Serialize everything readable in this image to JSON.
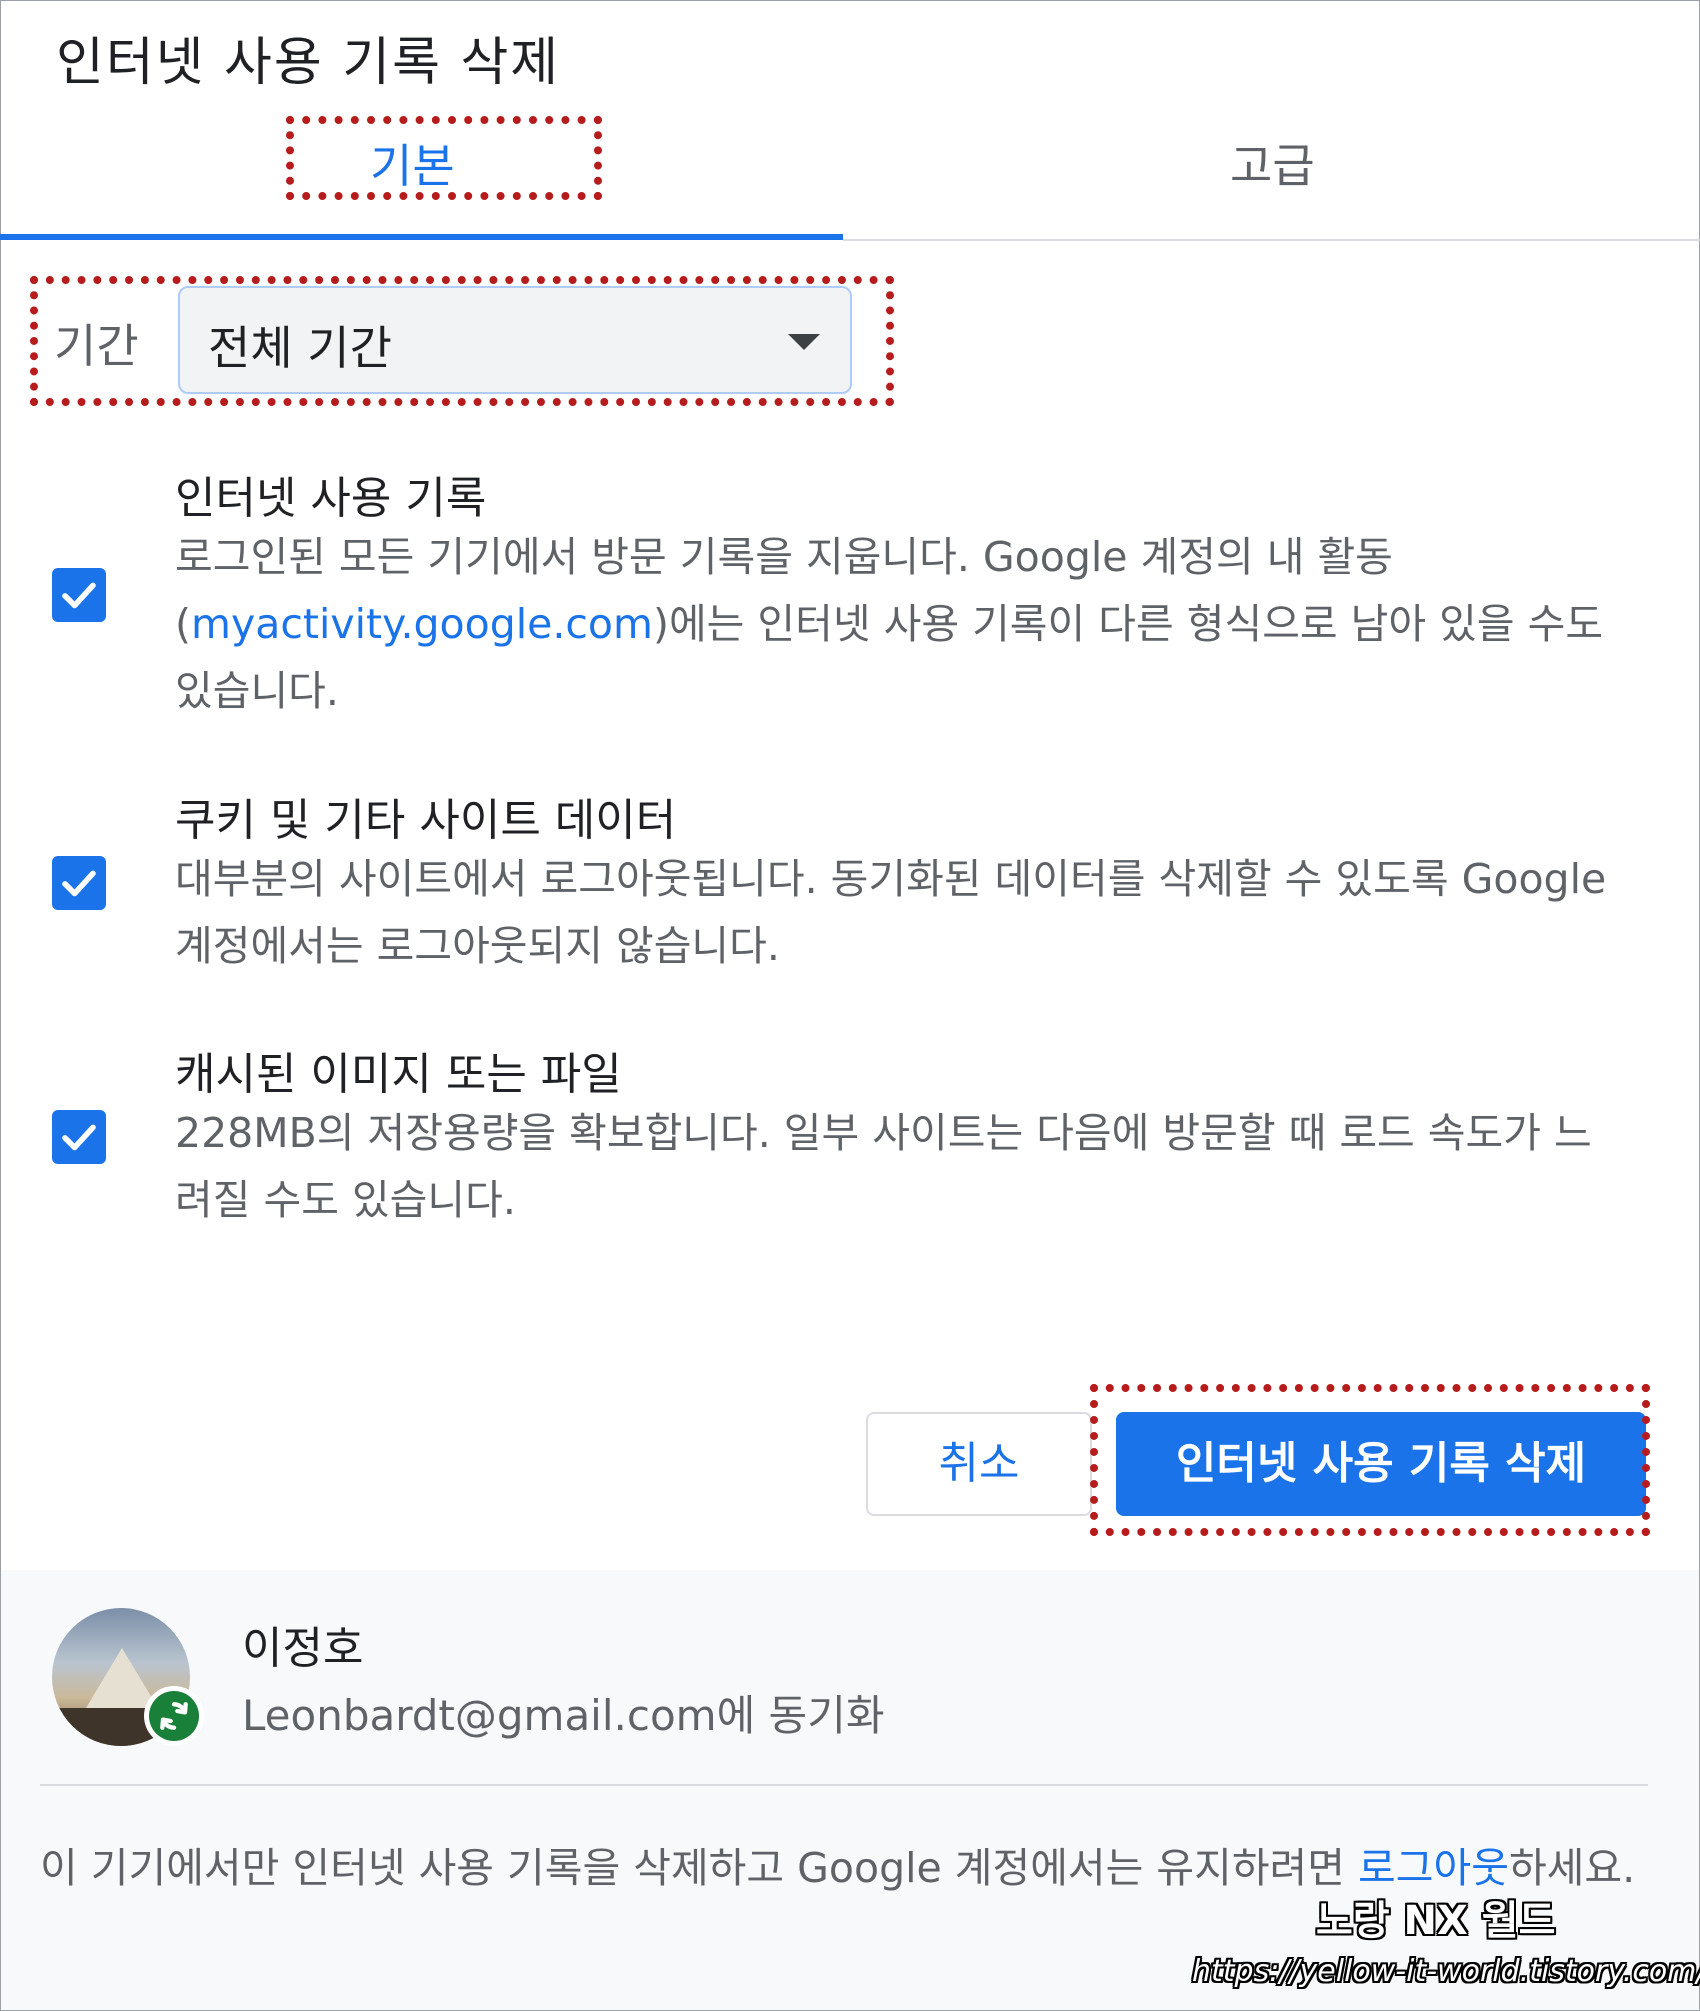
{
  "dialog": {
    "title": "인터넷 사용 기록 삭제"
  },
  "tabs": [
    {
      "label": "기본",
      "selected": true
    },
    {
      "label": "고급",
      "selected": false
    }
  ],
  "time_range": {
    "label": "기간",
    "value": "전체 기간"
  },
  "options": [
    {
      "title": "인터넷 사용 기록",
      "desc_before": "로그인된 모든 기기에서 방문 기록을 지웁니다. Google 계정의 내 활동 (",
      "desc_link": "myactivity.google.com",
      "desc_after": ")에는 인터넷 사용 기록이 다른 형식으로 남아 있을 수도 있습니다.",
      "checked": true
    },
    {
      "title": "쿠키 및 기타 사이트 데이터",
      "desc": "대부분의 사이트에서 로그아웃됩니다. 동기화된 데이터를 삭제할 수 있도록 Google 계정에서는 로그아웃되지 않습니다.",
      "checked": true
    },
    {
      "title": "캐시된 이미지 또는 파일",
      "desc": "228MB의 저장용량을 확보합니다. 일부 사이트는 다음에 방문할 때 로드 속도가 느려질 수도 있습니다.",
      "checked": true
    }
  ],
  "buttons": {
    "cancel": "취소",
    "delete": "인터넷 사용 기록 삭제"
  },
  "account": {
    "name": "이정호",
    "sync_text": "Leonbardt@gmail.com에 동기화"
  },
  "footer_note": {
    "text": "이 기기에서만 인터넷 사용 기록을 삭제하고 Google 계정에서는 유지하려면 ",
    "link": "로그아웃",
    "text_after": "하세요."
  },
  "watermark": {
    "title": "노랑 NX 월드",
    "url": "https://yellow-it-world.tistory.com/"
  },
  "colors": {
    "accent": "#1a73e8",
    "highlight": "#b71c1c",
    "sync_badge": "#188038"
  }
}
